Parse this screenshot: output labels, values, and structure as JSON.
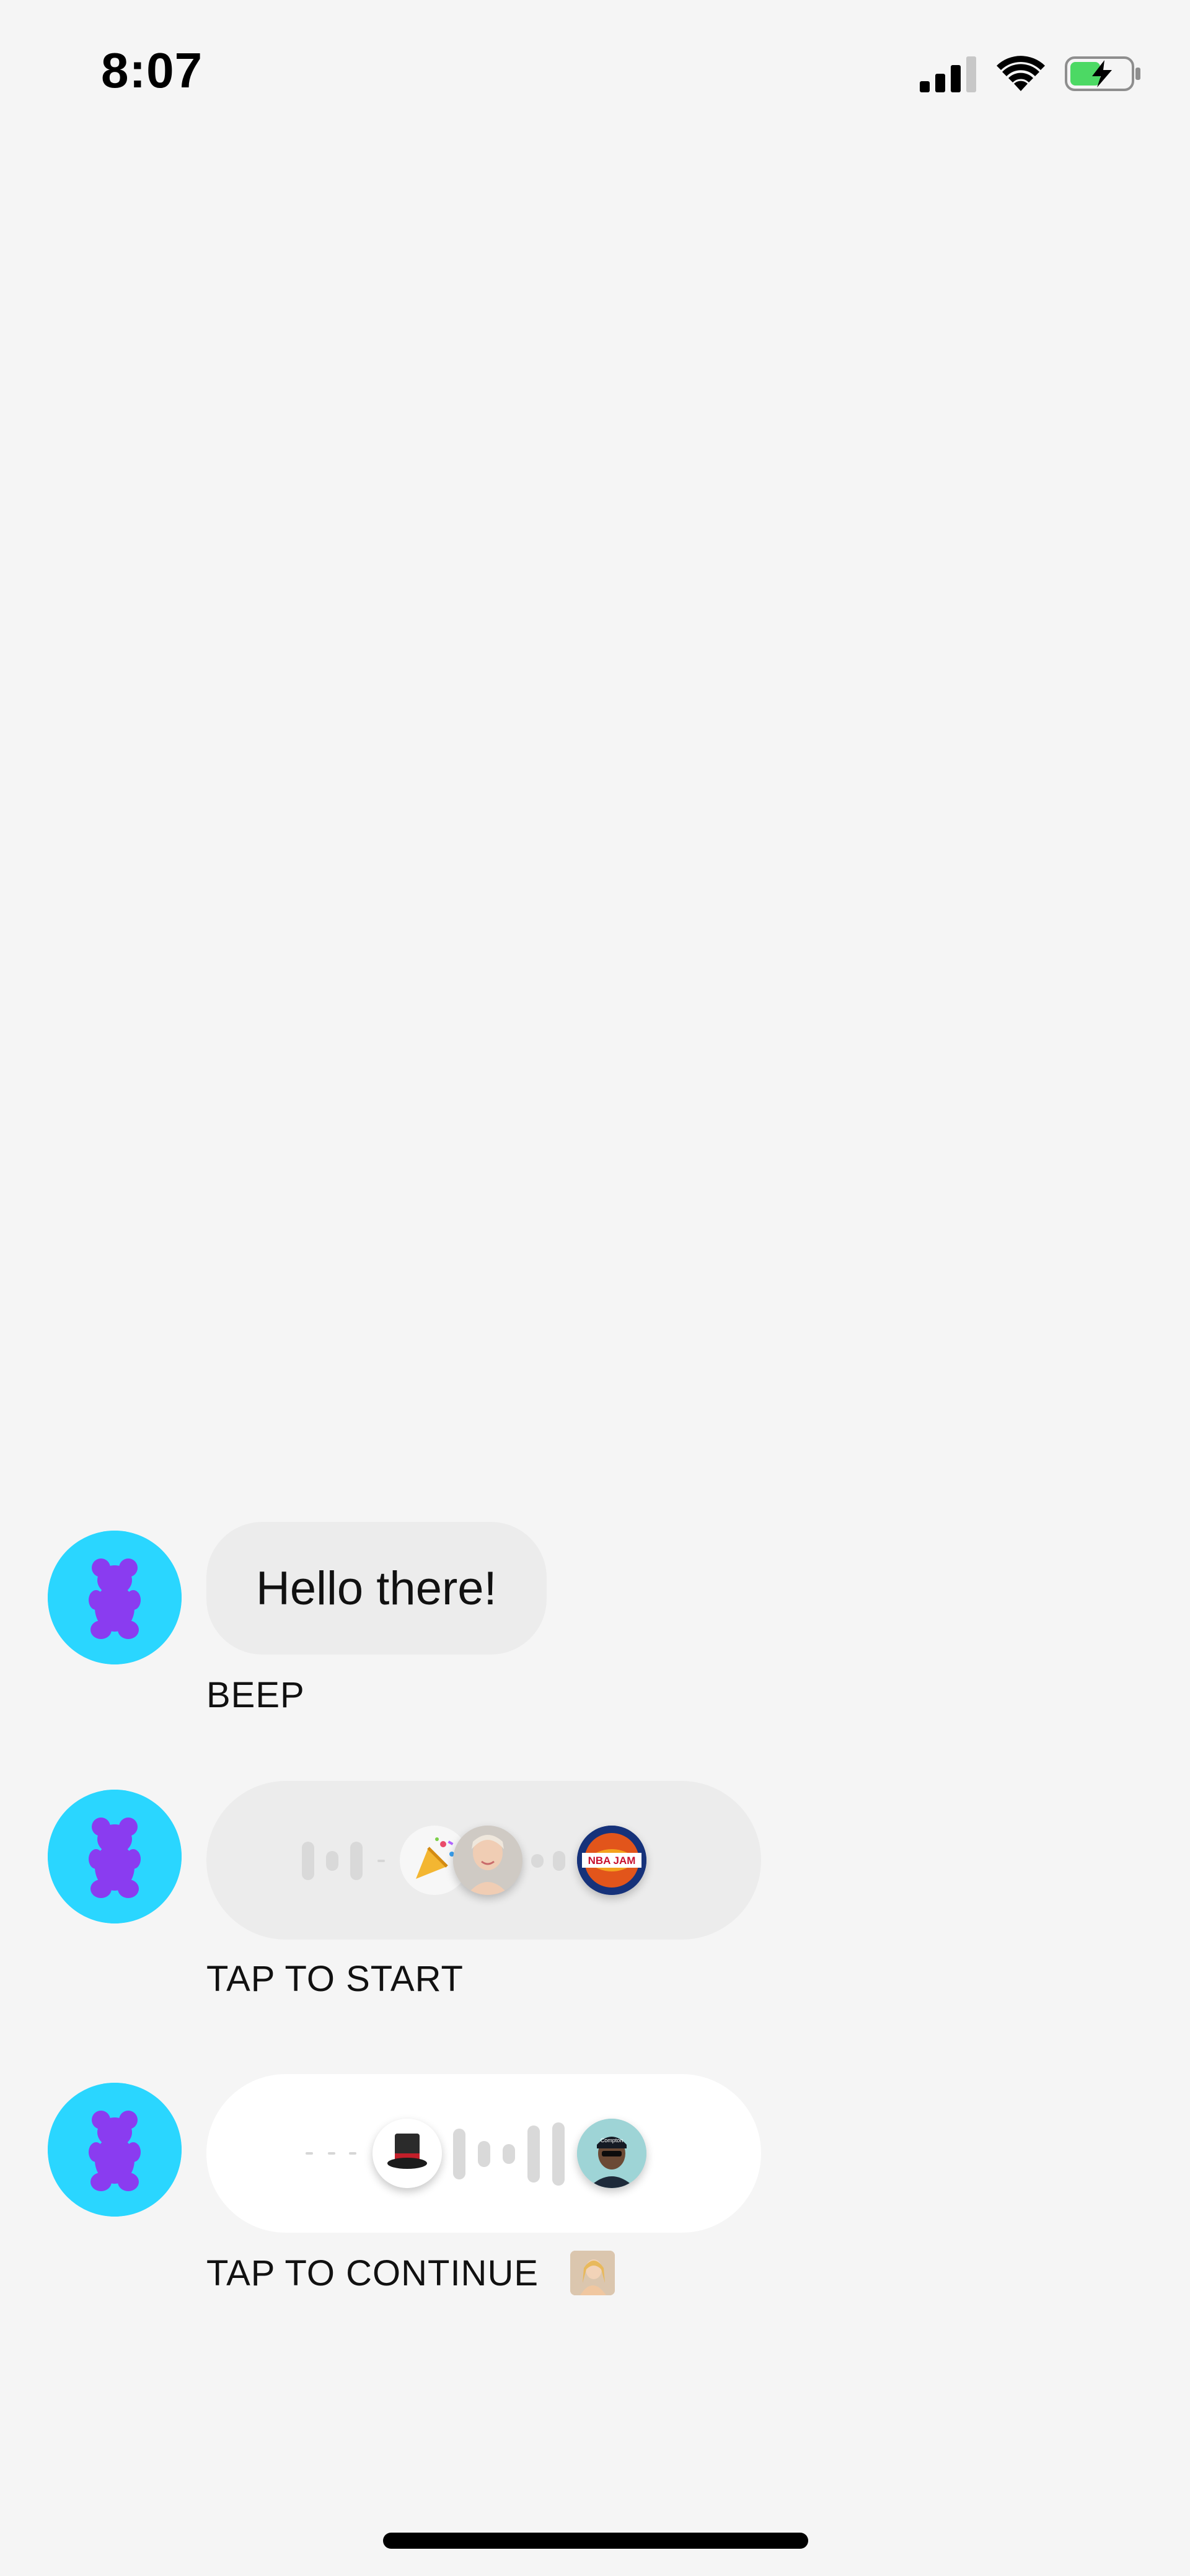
{
  "status_bar": {
    "time": "8:07",
    "signal_icon": "cellular-signal-icon",
    "wifi_icon": "wifi-icon",
    "battery_icon": "battery-charging-icon"
  },
  "messages": [
    {
      "type": "text",
      "text": "Hello there!",
      "caption": "BEEP",
      "avatar_icon": "gummy-bear-icon"
    },
    {
      "type": "audio",
      "caption": "TAP TO START",
      "avatar_icon": "gummy-bear-icon",
      "thumbnails": [
        "party-popper-thumbnail",
        "person-photo-thumbnail",
        "nba-jam-thumbnail"
      ]
    },
    {
      "type": "audio",
      "caption": "TAP TO CONTINUE",
      "avatar_icon": "gummy-bear-icon",
      "thumbnails": [
        "top-hat-thumbnail",
        "person-in-cap-thumbnail"
      ],
      "caption_thumbnail": "person-photo-thumbnail"
    }
  ],
  "colors": {
    "background": "#f5f5f5",
    "avatar_bg": "#2ad6ff",
    "avatar_bear": "#8a3cf0",
    "bubble_gray": "#ececec",
    "bubble_white": "#ffffff",
    "wave_bar": "#d9d9d9",
    "battery_fill": "#4cd964"
  }
}
